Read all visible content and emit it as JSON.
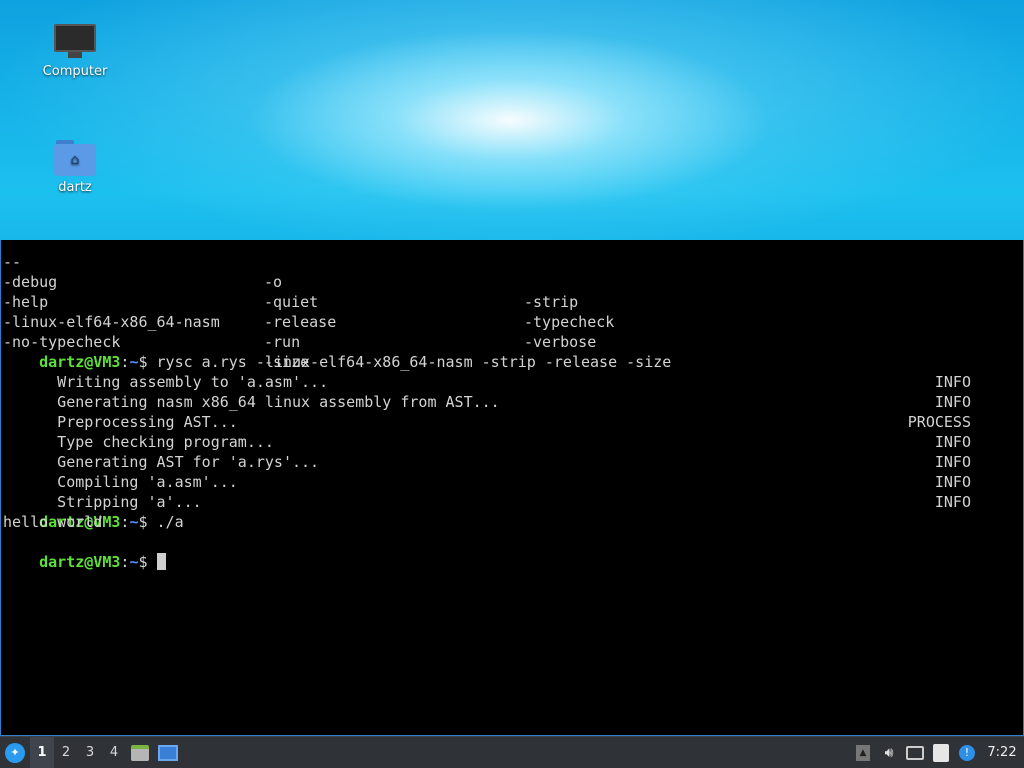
{
  "desktop": {
    "icons": [
      {
        "label": "Computer",
        "icon": "computer-icon"
      },
      {
        "label": "dartz",
        "icon": "home-folder-icon"
      }
    ]
  },
  "terminal": {
    "options_rows": [
      [
        "--",
        "-o",
        "-strip"
      ],
      [
        "-debug",
        "-quiet",
        "-typecheck"
      ],
      [
        "-help",
        "-release",
        "-verbose"
      ],
      [
        "-linux-elf64-x86_64-nasm",
        "-run",
        ""
      ],
      [
        "-no-typecheck",
        "-size",
        ""
      ]
    ],
    "prompt_user": "dartz@VM3",
    "prompt_sep": ":",
    "prompt_dir": "~",
    "prompt_symbol": "$",
    "command1": " rysc a.rys -linux-elf64-x86_64-nasm -strip -release -size",
    "log": [
      {
        "msg": "  Writing assembly to 'a.asm'...",
        "level": "INFO"
      },
      {
        "msg": "  Generating nasm x86_64 linux assembly from AST...",
        "level": "INFO"
      },
      {
        "msg": "  Preprocessing AST...",
        "level": "PROCESS"
      },
      {
        "msg": "  Type checking program...",
        "level": "INFO"
      },
      {
        "msg": "  Generating AST for 'a.rys'...",
        "level": "INFO"
      },
      {
        "msg": "  Compiling 'a.asm'...",
        "level": "INFO"
      },
      {
        "msg": "  Stripping 'a'...",
        "level": "INFO"
      }
    ],
    "command2": " ./a",
    "output": "hello world",
    "command3": " "
  },
  "taskbar": {
    "workspaces": [
      "1",
      "2",
      "3",
      "4"
    ],
    "active_workspace": "1",
    "clock": "7:22"
  }
}
